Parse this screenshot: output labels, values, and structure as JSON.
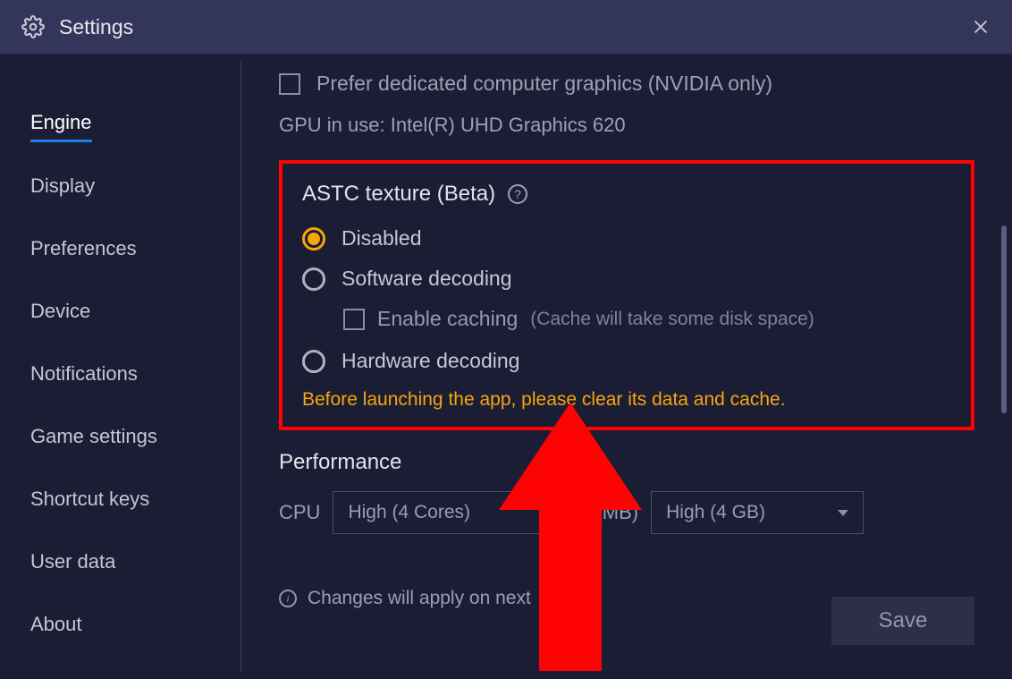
{
  "titlebar": {
    "title": "Settings"
  },
  "sidebar": {
    "items": [
      {
        "label": "Engine",
        "active": true
      },
      {
        "label": "Display",
        "active": false
      },
      {
        "label": "Preferences",
        "active": false
      },
      {
        "label": "Device",
        "active": false
      },
      {
        "label": "Notifications",
        "active": false
      },
      {
        "label": "Game settings",
        "active": false
      },
      {
        "label": "Shortcut keys",
        "active": false
      },
      {
        "label": "User data",
        "active": false
      },
      {
        "label": "About",
        "active": false
      }
    ]
  },
  "gpu": {
    "prefer_dedicated_label": "Prefer dedicated computer graphics (NVIDIA only)",
    "in_use_text": "GPU in use: Intel(R) UHD Graphics 620"
  },
  "astc": {
    "heading": "ASTC texture (Beta)",
    "options": {
      "disabled": "Disabled",
      "software": "Software decoding",
      "hardware": "Hardware decoding"
    },
    "enable_caching_label": "Enable caching",
    "caching_note": "(Cache will take some disk space)",
    "warning": "Before launching the app, please clear its data and cache."
  },
  "performance": {
    "heading": "Performance",
    "cpu_label": "CPU",
    "cpu_value": "High (4 Cores)",
    "memory_label": "(MB)",
    "memory_value": "High (4 GB)"
  },
  "footer": {
    "changes_text": "Changes will apply on next",
    "save_label": "Save"
  }
}
